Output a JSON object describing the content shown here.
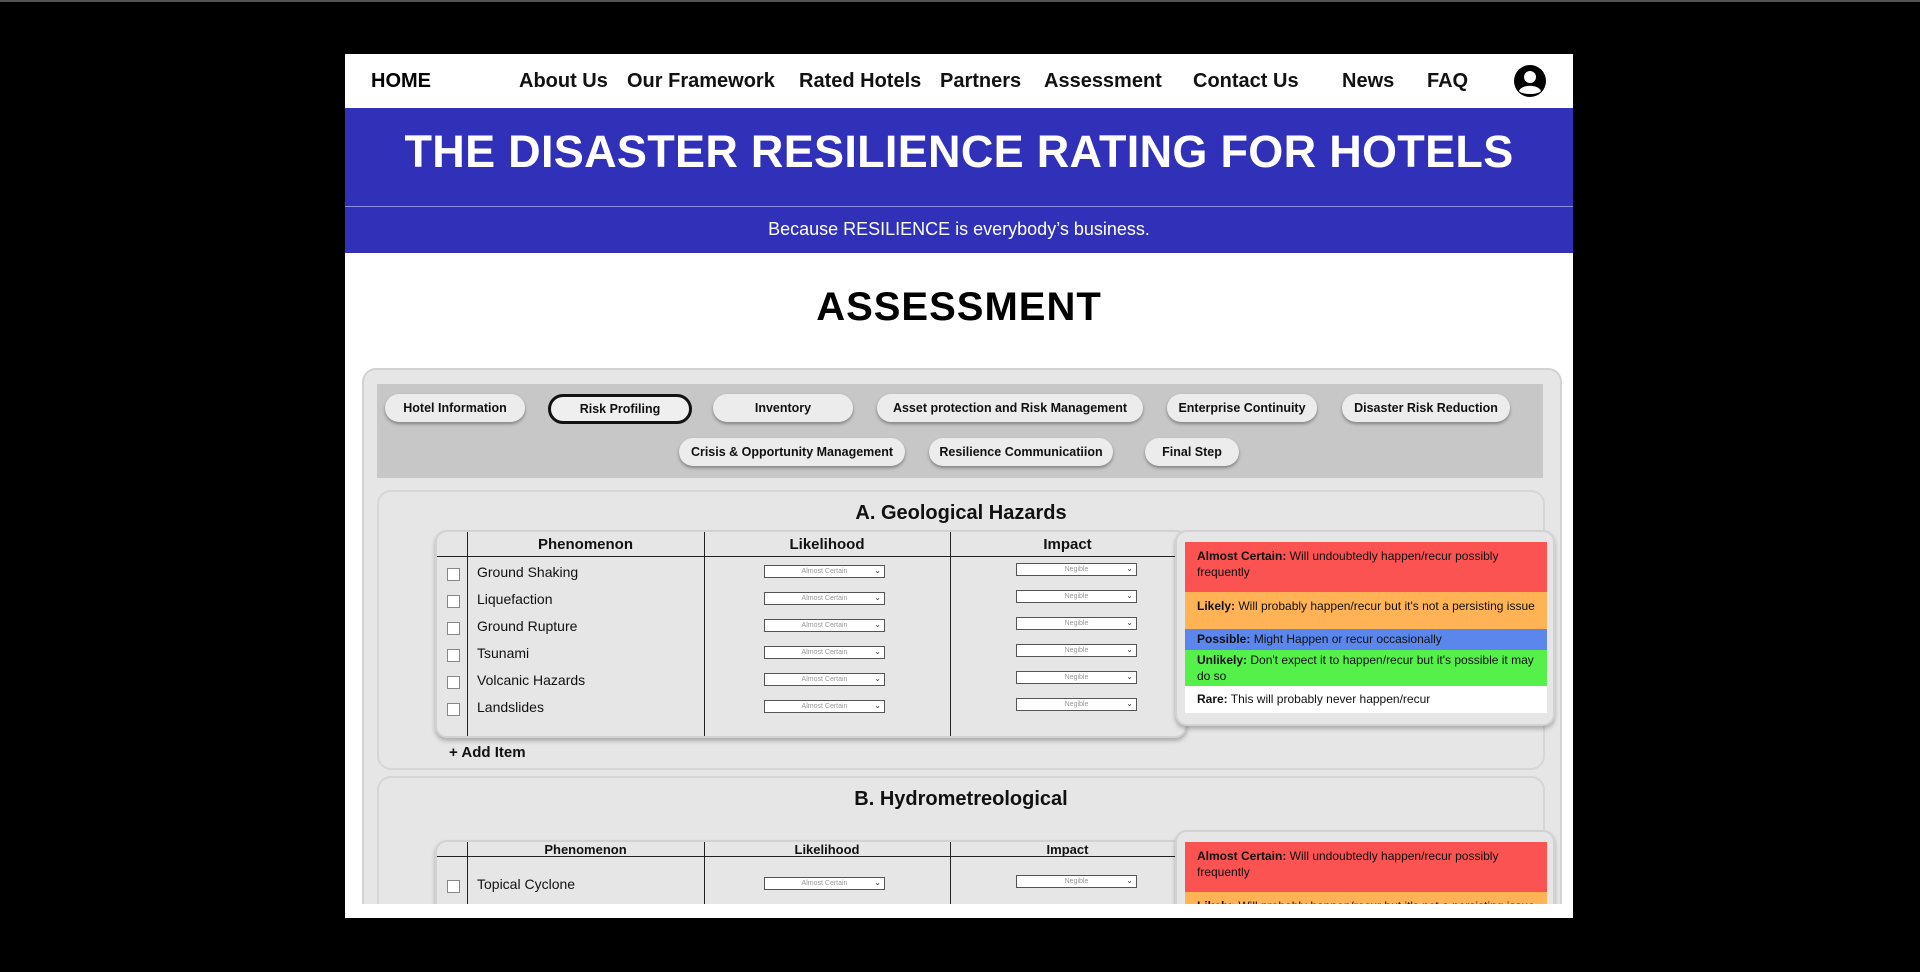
{
  "nav": {
    "home": "HOME",
    "links": [
      "About Us",
      "Our Framework",
      "Rated Hotels",
      "Partners",
      "Assessment",
      "Contact Us",
      "News",
      "FAQ"
    ]
  },
  "banner": {
    "title": "THE DISASTER RESILIENCE RATING FOR HOTELS",
    "tagline": "Because RESILIENCE is everybody’s business."
  },
  "page_title": "ASSESSMENT",
  "tabs": [
    {
      "label": "Hotel Information",
      "active": false
    },
    {
      "label": "Risk Profiling",
      "active": true
    },
    {
      "label": "Inventory",
      "active": false
    },
    {
      "label": "Asset protection and Risk Management",
      "active": false
    },
    {
      "label": "Enterprise Continuity",
      "active": false
    },
    {
      "label": "Disaster Risk Reduction",
      "active": false
    },
    {
      "label": "Crisis & Opportunity Management",
      "active": false
    },
    {
      "label": "Resilience Communicatiion",
      "active": false
    },
    {
      "label": "Final Step",
      "active": false
    }
  ],
  "sections": [
    {
      "title": "A. Geological Hazards",
      "headers": [
        "Phenomenon",
        "Likelihood",
        "Impact"
      ],
      "rows": [
        {
          "label": "Ground Shaking",
          "likelihood": "Almost Certain",
          "impact": "Negible"
        },
        {
          "label": "Liquefaction",
          "likelihood": "Almost Certain",
          "impact": "Negible"
        },
        {
          "label": "Ground Rupture",
          "likelihood": "Almost Certain",
          "impact": "Negible"
        },
        {
          "label": "Tsunami",
          "likelihood": "Almost Certain",
          "impact": "Negible"
        },
        {
          "label": "Volcanic Hazards",
          "likelihood": "Almost Certain",
          "impact": "Negible"
        },
        {
          "label": "Landslides",
          "likelihood": "Almost Certain",
          "impact": "Negible"
        }
      ],
      "add_item": "+ Add Item"
    },
    {
      "title": "B. Hydrometreological",
      "headers": [
        "Phenomenon",
        "Likelihood",
        "Impact"
      ],
      "rows": [
        {
          "label": "Topical Cyclone",
          "likelihood": "Almost Certain",
          "impact": "Negible"
        }
      ]
    }
  ],
  "legend": [
    {
      "term": "Almost Certain:",
      "desc": " Will undoubtedly happen/recur possibly frequently",
      "color": "#fb5252"
    },
    {
      "term": "Likely:",
      "desc": " Will probably happen/recur but it's not a persisting issue",
      "color": "#ffb354"
    },
    {
      "term": "Possible:",
      "desc": " Might Happen or recur occasionally",
      "color": "#5b86ec"
    },
    {
      "term": "Unlikely:",
      "desc": " Don't expect it to happen/recur but it's possible it may do so",
      "color": "#55f04a"
    },
    {
      "term": "Rare:",
      "desc": " This will probably never happen/recur",
      "color": "#ffffff"
    }
  ]
}
